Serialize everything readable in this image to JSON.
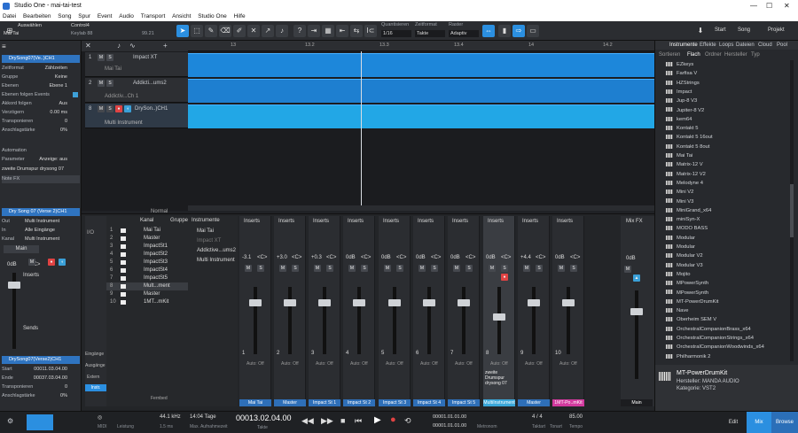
{
  "window": {
    "title": "Studio One - mai-tai-test",
    "min": "—",
    "max": "☐",
    "close": "✕"
  },
  "menu": [
    "Datei",
    "Bearbeiten",
    "Song",
    "Spur",
    "Event",
    "Audio",
    "Transport",
    "Ansicht",
    "Studio One",
    "Hilfe"
  ],
  "toolbar": {
    "select_label": "Auswählen",
    "device_label": "Mai Tai",
    "control_label": "Control4",
    "keylab_label": "Keylab 88",
    "value": "99.21",
    "quantize_label": "Quantisieren",
    "quantize_value": "1/16",
    "timebase_label": "Zeitformat",
    "timebase_value": "Takte",
    "snap_label": "Raster",
    "snap_value": "Adaptiv",
    "start_label": "Start",
    "song_label": "Song",
    "project_label": "Projekt"
  },
  "inspector": {
    "track_name": "DrySong07(Ve..)CH1",
    "rows": [
      {
        "k": "Zeitformat",
        "v": "Zählzeiten"
      },
      {
        "k": "Gruppe",
        "v": "Keine"
      },
      {
        "k": "Ebenen",
        "v": "Ebene 1"
      },
      {
        "k": "Ebenen folgen Events",
        "v": ""
      },
      {
        "k": "Akkord folgen",
        "v": "Aus"
      },
      {
        "k": "Verzögern",
        "v": "0.00 ms"
      },
      {
        "k": "Transponieren",
        "v": "0"
      },
      {
        "k": "Anschlagstärke",
        "v": "0%"
      }
    ],
    "automation": "Automation",
    "param": "Parameter",
    "param_v": "Anzeige: aus",
    "drum": "zweite Drumspur drysong 07",
    "notefx": "Note FX",
    "channel_name": "Dry Song 07 (Verse 2)CH1",
    "out": "Out",
    "out_v": "Multi Instrument",
    "in": "In",
    "in_v": "Alle Eingänge",
    "kanal": "Kanal",
    "kanal_v": "Multi Instrument",
    "main": "Main",
    "db": "0dB",
    "cdb": "<C>",
    "inserts": "Inserts",
    "sends": "Sends",
    "event_name": "DrySong07(Verse2)CH1",
    "start": "Start",
    "start_v": "00011.03.04.00",
    "end": "Ende",
    "end_v": "00037.03.04.00",
    "transp": "Transponieren",
    "transp_v": "0",
    "vel": "Anschlagstärke",
    "vel_v": "0%"
  },
  "ruler": [
    "13",
    "13.2",
    "13.3",
    "13.4",
    "14",
    "14.2"
  ],
  "tracks": [
    {
      "num": "1",
      "name": "Impact XT",
      "sub": "Mai Tai"
    },
    {
      "num": "2",
      "name": "Addicti...ums2",
      "sub": "Addictiv...Ch 1"
    },
    {
      "num": "8",
      "name": "DrySon..)CH1",
      "sub": "Multi Instrument"
    }
  ],
  "mixer_panel": {
    "channels": [
      {
        "n": "1",
        "name": "Mai Tai"
      },
      {
        "n": "2",
        "name": "Master"
      },
      {
        "n": "3",
        "name": "ImpactSt1"
      },
      {
        "n": "4",
        "name": "ImpactSt2"
      },
      {
        "n": "5",
        "name": "ImpactSt3"
      },
      {
        "n": "6",
        "name": "ImpactSt4"
      },
      {
        "n": "7",
        "name": "ImpactSt5"
      },
      {
        "n": "8",
        "name": "Mult...ment"
      },
      {
        "n": "9",
        "name": "Master"
      },
      {
        "n": "10",
        "name": "1MT...mKit"
      }
    ],
    "col_kanal": "Kanal",
    "col_gruppe": "Gruppe",
    "col_instr": "Instrumente",
    "instruments": [
      "Mai Tai",
      "Impact XT",
      "Addictive...ums2",
      "Multi Instrument"
    ],
    "fernbed": "Fernbed",
    "normal": "Normal",
    "eingange": "Eingänge",
    "ausgange": "Ausgänge",
    "extern": "Extern",
    "instr": "Instr.",
    "mixfx": "Mix FX"
  },
  "strips": [
    {
      "name": "Mai Tai",
      "db": "-3.1",
      "num": "1",
      "color": "#2e6fb8"
    },
    {
      "name": "Master",
      "db": "+3.0",
      "num": "2",
      "color": "#2e6fb8"
    },
    {
      "name": "Impact St 1",
      "db": "+0.3",
      "num": "3",
      "color": "#2e6fb8"
    },
    {
      "name": "Impact St 2",
      "db": "0dB",
      "num": "4",
      "color": "#2e6fb8"
    },
    {
      "name": "Impact St 3",
      "db": "0dB",
      "num": "5",
      "color": "#2e6fb8"
    },
    {
      "name": "Impact St 4",
      "db": "0dB",
      "num": "6",
      "color": "#2e6fb8"
    },
    {
      "name": "Impact St 5",
      "db": "0dB",
      "num": "7",
      "color": "#2e6fb8"
    },
    {
      "name": "MultiInstrument",
      "db": "0dB",
      "num": "8",
      "color": "#3aa7d9"
    },
    {
      "name": "Master",
      "db": "+4.4",
      "num": "9",
      "color": "#2e6fb8"
    },
    {
      "name": "1MT-Po..mKit",
      "db": "0dB",
      "num": "10",
      "color": "#d23a9e"
    }
  ],
  "strip_common": {
    "inserts": "Inserts",
    "auto": "Auto: Off",
    "cdb": "<C>",
    "strip8_note": "zweite Drumspur drysong 07"
  },
  "main_strip": {
    "name": "Main",
    "db": "0dB"
  },
  "browser": {
    "tabs": [
      "Instrumente",
      "Effekte",
      "Loops",
      "Dateien",
      "Cloud",
      "Pool"
    ],
    "subtabs": [
      "Sortieren",
      "Flach",
      "Ordner",
      "Hersteller",
      "Typ"
    ],
    "items": [
      "EZkeys",
      "Farfisa V",
      "HZStrings",
      "Impact",
      "Jup-8 V3",
      "Jupiter-8 V2",
      "kem64",
      "Kontakt 5",
      "Kontakt 5 16out",
      "Kontakt 5 8out",
      "Mai Tai",
      "Matrix-12 V",
      "Matrix-12 V2",
      "Melodyne 4",
      "Mini V2",
      "Mini V3",
      "MiniGrand_x64",
      "miniSyn-X",
      "MODO BASS",
      "Modular",
      "Modular",
      "Modular V2",
      "Modular V3",
      "Mojito",
      "MPowerSynth",
      "MPowerSynth",
      "MT-PowerDrumKit",
      "Nave",
      "Oberheim SEM V",
      "OrchestralCompanionBrass_x64",
      "OrchestralCompanionStrings_x64",
      "OrchestralCompanionWoodwinds_x64",
      "Philharmonik 2"
    ],
    "footer_name": "MT-PowerDrumKit",
    "footer_maker": "Hersteller:   MANDA AUDIO",
    "footer_cat": "Kategorie:   VST2"
  },
  "transport": {
    "midi": "MIDI",
    "perf": "Leistung",
    "rate": "44.1 kHz",
    "latency": "1.5 ms",
    "days": "14:04 Tage",
    "maxrec": "Max. Aufnahmezeit",
    "time": "00013.02.04.00",
    "time_lbl": "Takte",
    "loop_l": "00001.01.01.00",
    "loop_r": "00001.01.01.00",
    "sig": "4 / 4",
    "sig_lbl": "Taktart",
    "key_lbl": "Tonart",
    "tempo": "85.00",
    "tempo_lbl": "Tempo",
    "metro": "Metronom",
    "edit": "Edit",
    "mix": "Mix",
    "browse": "Browse"
  }
}
